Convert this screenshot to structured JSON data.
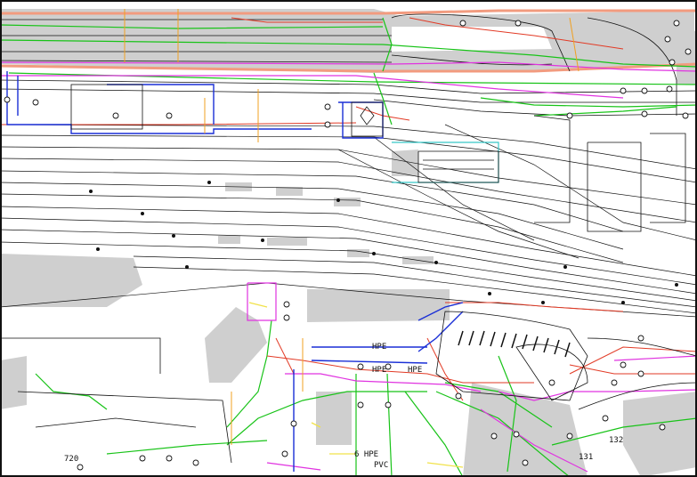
{
  "map": {
    "colors": {
      "road": "#cfcfcf",
      "dark": "#111111",
      "salmon": "#f29b7f",
      "green": "#18c318",
      "magenta": "#e033e0",
      "red": "#e23a25",
      "blue": "#1a2fd6",
      "orange": "#f0a020",
      "yellow": "#f1e24a",
      "cyan": "#36c7c7",
      "purple": "#8a3fd6"
    },
    "labels": {
      "pipe_hpe_1": "HPE",
      "pipe_hpe_2": "HPE",
      "pipe_hpe_3": "HPE",
      "pipe_pvc": "PVC",
      "pipe_hpe_bottom": "6 HPE",
      "code_720": "720",
      "code_132": "132",
      "code_131": "131"
    }
  }
}
